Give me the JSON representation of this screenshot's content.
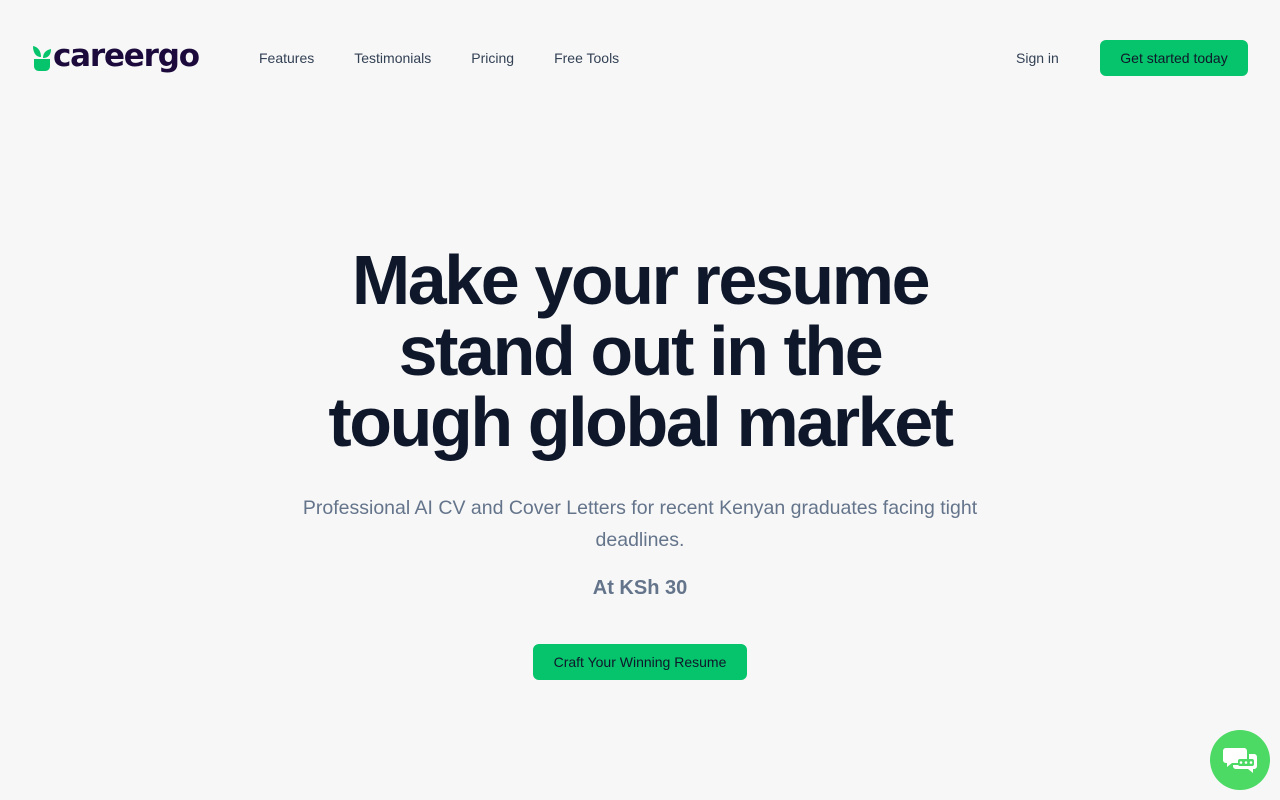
{
  "brand": {
    "name": "careergo",
    "logo_icon": "leaf-icon",
    "colors": {
      "primary": "#06c46b",
      "dark": "#1b0a3b",
      "chat": "#4cd964"
    }
  },
  "nav": {
    "items": [
      {
        "label": "Features"
      },
      {
        "label": "Testimonials"
      },
      {
        "label": "Pricing"
      },
      {
        "label": "Free Tools"
      }
    ],
    "signin_label": "Sign in",
    "cta_label": "Get started today"
  },
  "hero": {
    "title_lines": [
      "Make your resume",
      "stand out in the",
      "tough global market"
    ],
    "subtitle": "Professional AI CV and Cover Letters for recent Kenyan graduates facing tight deadlines.",
    "price": "At KSh 30",
    "cta_label": "Craft Your Winning Resume"
  },
  "chat_widget": {
    "icon": "chat-bubbles-icon"
  }
}
